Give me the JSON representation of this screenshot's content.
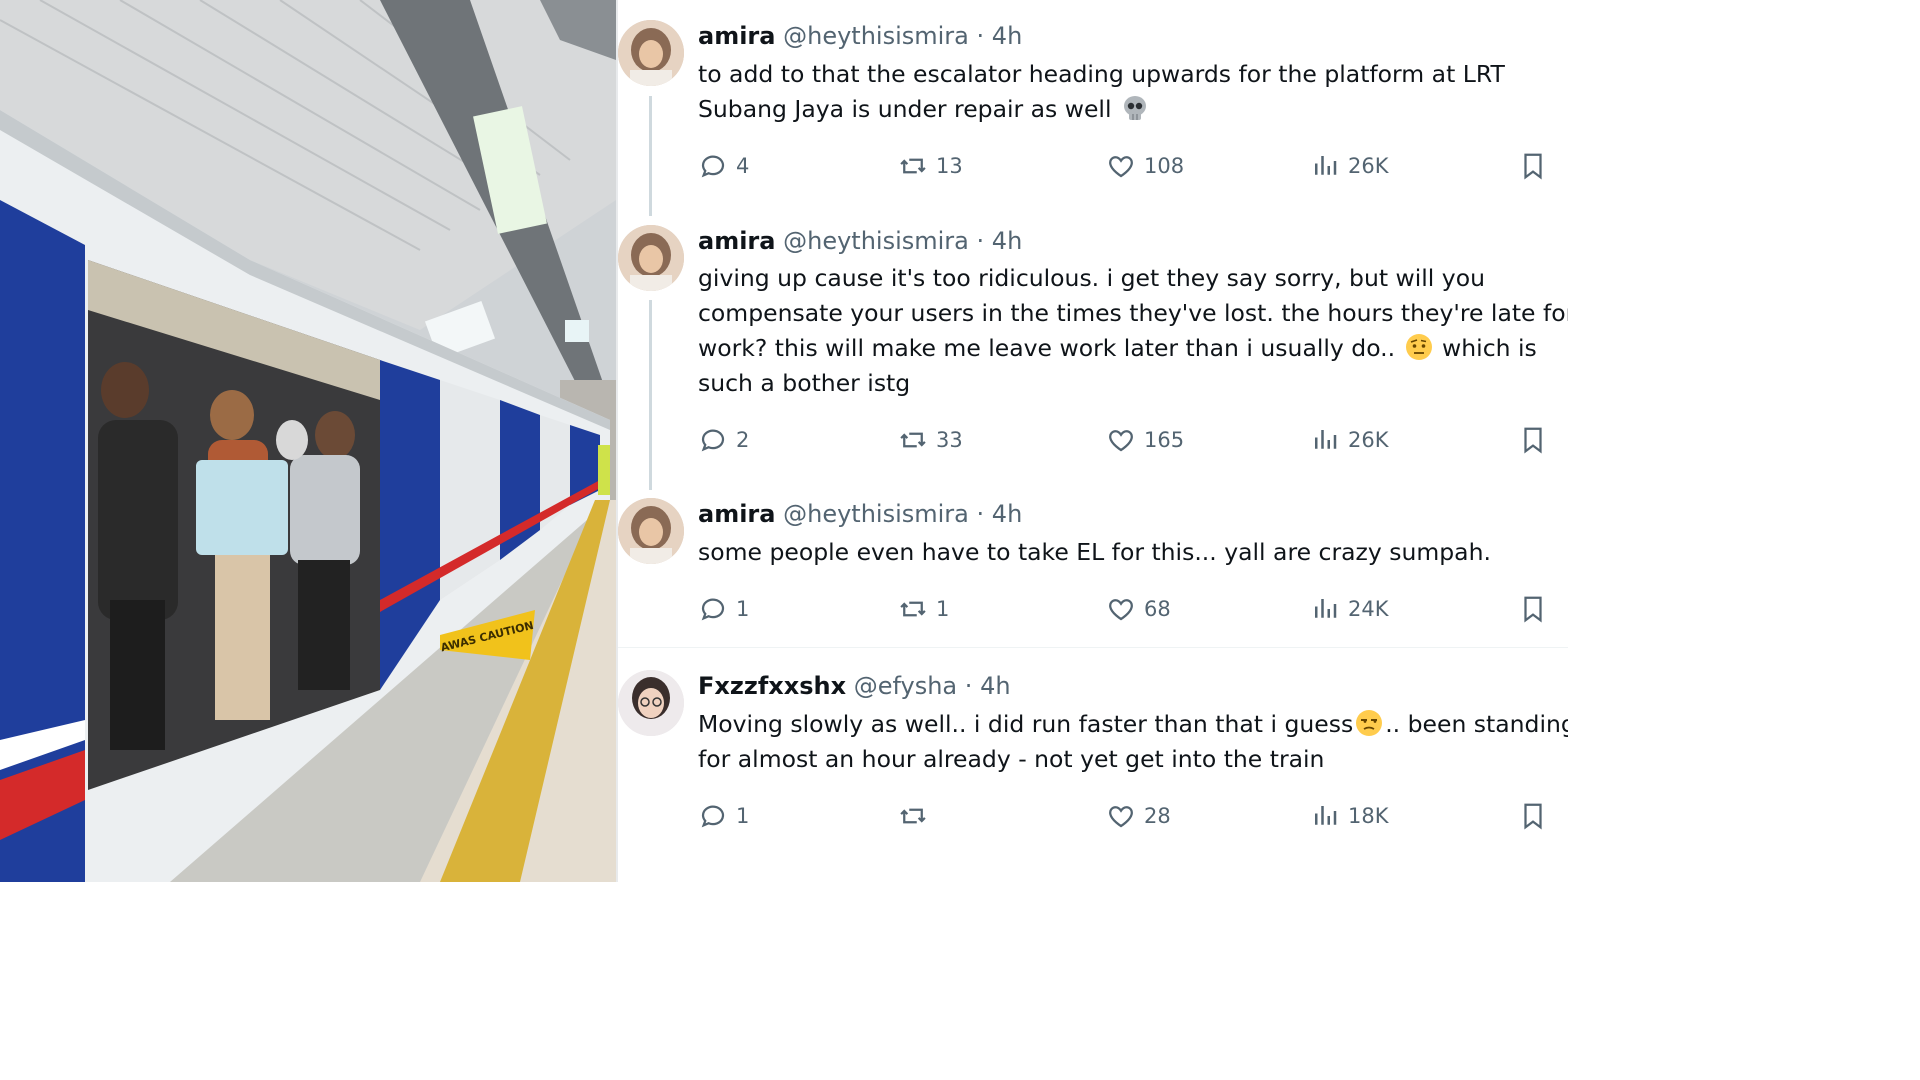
{
  "photo": {
    "caution_sign": "AWAS CAUTION"
  },
  "tweets": [
    {
      "name": "amira",
      "handle": "@heythisismira",
      "dot": "·",
      "time": "4h",
      "text_before": "to add to that the escalator heading upwards for the platform at LRT\nSubang Jaya is under repair as well ",
      "emoji": "skull-emoji",
      "text_after": "",
      "replies": "4",
      "reposts": "13",
      "likes": "108",
      "views": "26K"
    },
    {
      "name": "amira",
      "handle": "@heythisismira",
      "dot": "·",
      "time": "4h",
      "text_before": "giving up cause it's too ridiculous. i get they say sorry, but will you\ncompensate your users in the times they've lost. the hours they're late for\nwork? this will make me leave work later than i usually do.. ",
      "emoji": "raised-eyebrow-emoji",
      "text_after": " which is\nsuch a bother istg",
      "replies": "2",
      "reposts": "33",
      "likes": "165",
      "views": "26K"
    },
    {
      "name": "amira",
      "handle": "@heythisismira",
      "dot": "·",
      "time": "4h",
      "text_before": "some people even have to take EL for this... yall are crazy sumpah.",
      "emoji": "",
      "text_after": "",
      "replies": "1",
      "reposts": "1",
      "likes": "68",
      "views": "24K"
    },
    {
      "name": "Fxzzfxxshx",
      "handle": "@efysha",
      "dot": "·",
      "time": "4h",
      "text_before": "Moving slowly as well.. i did run faster than that i guess",
      "emoji": "unamused-emoji",
      "text_after": ".. been standing\nfor almost an hour already - not yet get into the train",
      "replies": "1",
      "reposts": "",
      "likes": "28",
      "views": "18K"
    }
  ],
  "icons": {
    "reply": "reply-icon",
    "repost": "repost-icon",
    "like": "like-icon",
    "views": "views-icon",
    "bookmark": "bookmark-icon"
  },
  "colors": {
    "text": "#0f1419",
    "secondary": "#536471",
    "thread_line": "#cfd9de"
  }
}
